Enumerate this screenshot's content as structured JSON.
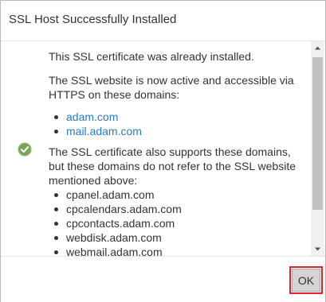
{
  "dialog": {
    "title": "SSL Host Successfully Installed"
  },
  "content": {
    "status_icon": "check-circle-icon",
    "already_installed": "This SSL certificate was already installed.",
    "active_line1": "The SSL website is now active and accessible via",
    "active_line2": "HTTPS on these domains:",
    "active_domains": [
      "adam.com",
      "mail.adam.com"
    ],
    "supports_line1": "The SSL certificate also supports these domains,",
    "supports_line2": "but these domains do not refer to the SSL website",
    "supports_line3": "mentioned above:",
    "other_domains": [
      "cpanel.adam.com",
      "cpcalendars.adam.com",
      "cpcontacts.adam.com",
      "webdisk.adam.com",
      "webmail.adam.com"
    ]
  },
  "footer": {
    "ok_label": "OK"
  },
  "colors": {
    "link": "#2a7ac4",
    "highlight": "#e0212b",
    "check": "#7aa35a"
  }
}
